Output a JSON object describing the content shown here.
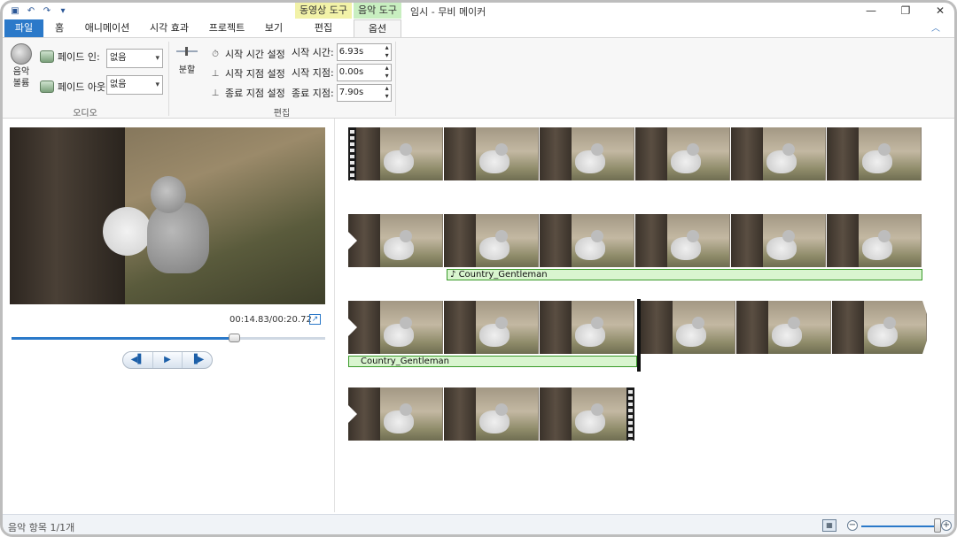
{
  "window": {
    "title": "임시 - 무비 메이커",
    "contextual_groups": {
      "video_tools": "동영상 도구",
      "music_tools": "음악 도구"
    },
    "controls": {
      "minimize": "—",
      "restore": "❐",
      "close": "✕"
    }
  },
  "quick_access": {
    "save_icon": "save-icon",
    "undo_icon": "undo-icon",
    "redo_icon": "redo-icon",
    "customize_icon": "chevron-down-icon"
  },
  "tabs": [
    "파일",
    "홈",
    "애니메이션",
    "시각 효과",
    "프로젝트",
    "보기",
    "편집",
    "옵션"
  ],
  "active_tab": "옵션",
  "ribbon": {
    "audio": {
      "volume_label_1": "음악",
      "volume_label_2": "볼륨",
      "fade_in_label": "페이드 인:",
      "fade_in_value": "없음",
      "fade_out_label": "페이드 아웃:",
      "fade_out_value": "없음",
      "group_label": "오디오"
    },
    "edit": {
      "split_label": "분할",
      "set_start_time": "시작 시간 설정",
      "set_start_point": "시작 지점 설정",
      "set_end_point": "종료 지점 설정",
      "start_time_label": "시작 시간:",
      "start_time_value": "6.93s",
      "start_point_label": "시작 지점:",
      "start_point_value": "0.00s",
      "end_point_label": "종료 지점:",
      "end_point_value": "7.90s",
      "group_label": "편집"
    }
  },
  "preview": {
    "time": "00:14.83/00:20.72",
    "seek_progress": 0.71,
    "buttons": {
      "prev": "◀▌",
      "play": "▶",
      "next": "▐▶"
    }
  },
  "storyboard": {
    "music_title": "Country_Gentleman",
    "music_title_2": "Country_Gentleman",
    "music_note": "♪"
  },
  "status": {
    "text": "음악 항목 1/1개",
    "zoom_minus": "−",
    "zoom_plus": "+",
    "zoom_level": 0.95
  }
}
